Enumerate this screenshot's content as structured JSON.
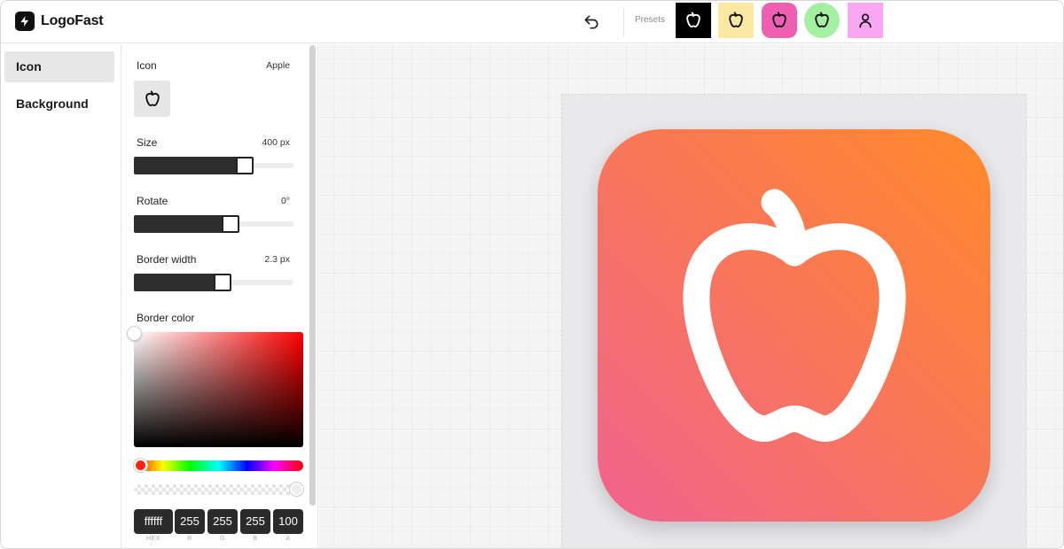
{
  "app": {
    "name": "LogoFast"
  },
  "header": {
    "presets_label": "Presets"
  },
  "presets": [
    {
      "bg": "#000000",
      "fg": "#ffffff",
      "shape": "square",
      "icon": "apple-icon"
    },
    {
      "bg": "#fbe9a3",
      "fg": "#111111",
      "shape": "square",
      "icon": "apple-icon"
    },
    {
      "bg": "#ee5fb2",
      "fg": "#111111",
      "shape": "rounded",
      "icon": "apple-icon"
    },
    {
      "bg": "#a4f0a2",
      "fg": "#111111",
      "shape": "circle",
      "icon": "apple-icon"
    },
    {
      "bg": "#f8a6f0",
      "fg": "#111111",
      "shape": "square",
      "icon": "user-icon"
    }
  ],
  "sidebar": {
    "items": [
      {
        "label": "Icon",
        "active": true
      },
      {
        "label": "Background",
        "active": false
      }
    ]
  },
  "panel": {
    "icon_label": "Icon",
    "icon_value": "Apple",
    "size_label": "Size",
    "size_value": "400 px",
    "size_level": 0.64,
    "rotate_label": "Rotate",
    "rotate_value": "0°",
    "rotate_level": 0.55,
    "border_width_label": "Border width",
    "border_width_value": "2.3 px",
    "border_width_level": 0.5,
    "border_color_label": "Border color",
    "color": {
      "hex": "ffffff",
      "r": "255",
      "g": "255",
      "b": "255",
      "a": "100"
    },
    "color_labels": {
      "hex": "HEX",
      "r": "R",
      "g": "G",
      "b": "B",
      "a": "A"
    }
  },
  "canvas": {
    "logo": {
      "icon": "apple-icon",
      "gradient_start": "#f0638f",
      "gradient_end": "#ff8a2a",
      "icon_color": "#ffffff"
    }
  }
}
